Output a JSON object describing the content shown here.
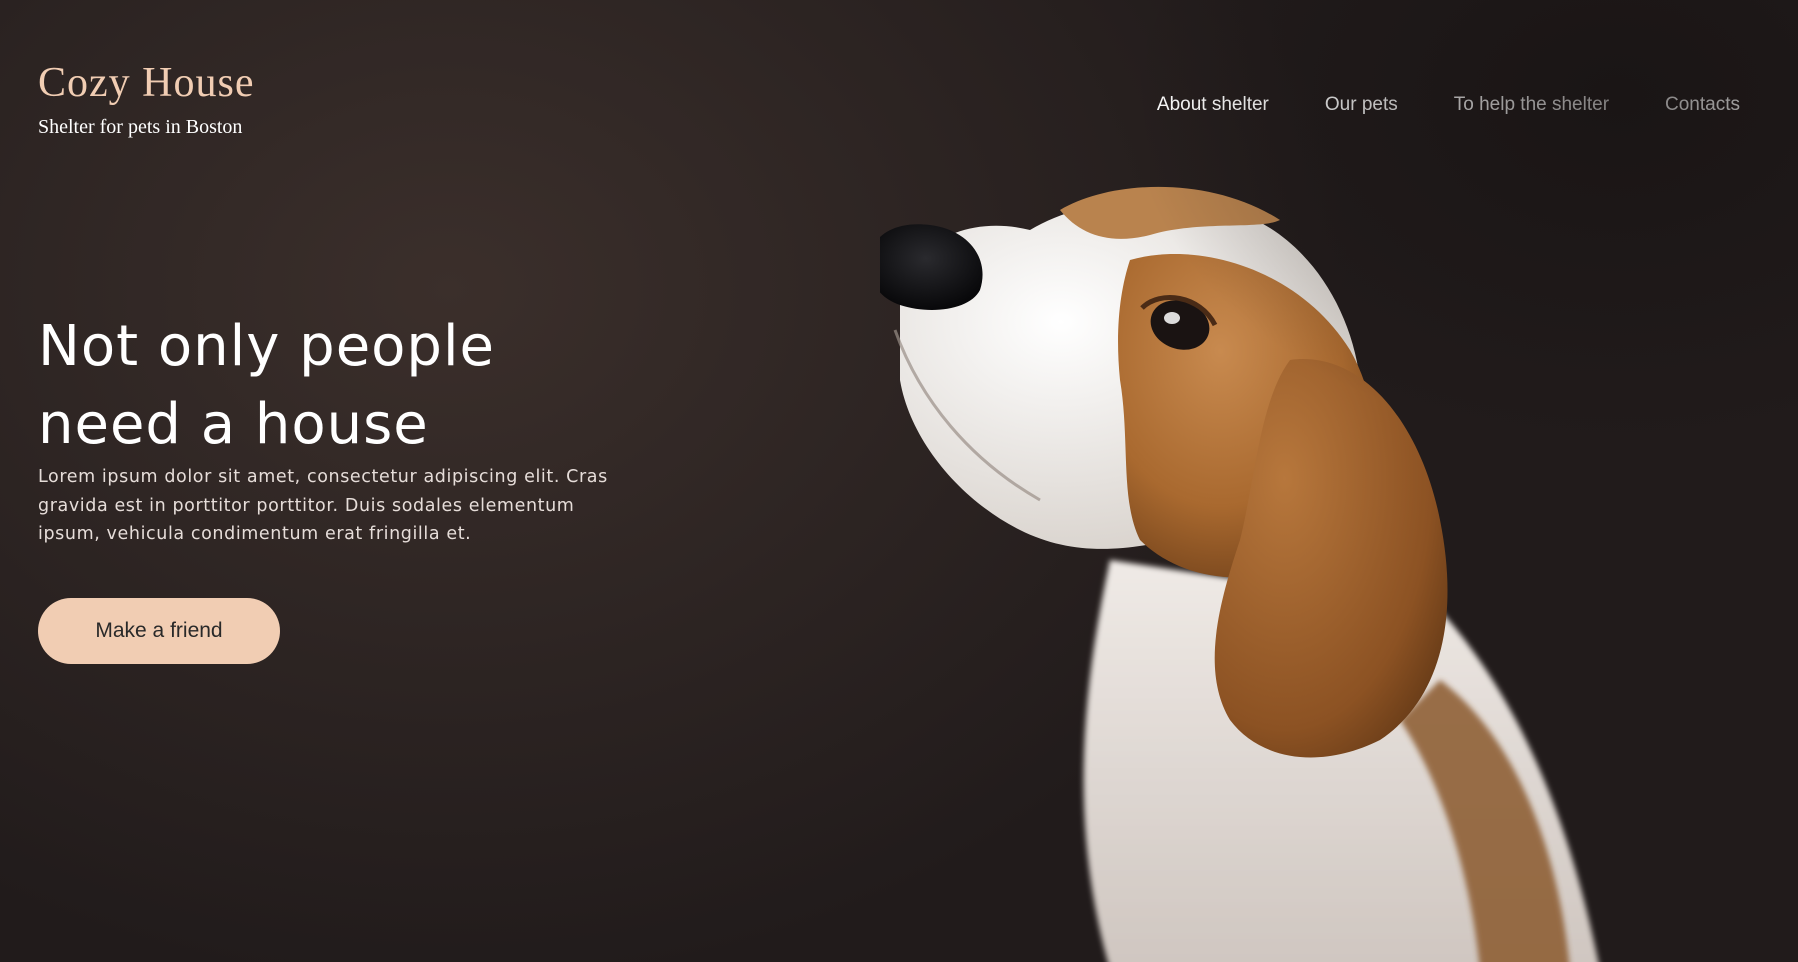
{
  "logo": {
    "title": "Cozy House",
    "subtitle": "Shelter for pets in Boston"
  },
  "nav": {
    "items": [
      "About shelter",
      "Our pets",
      "To help the shelter",
      "Contacts"
    ]
  },
  "hero": {
    "headline_line1": "Not only people",
    "headline_line2": "need a house",
    "lead": "Lorem ipsum dolor sit amet, consectetur adipiscing elit. Cras gravida est in porttitor porttitor. Duis sodales elementum ipsum, vehicula condimentum erat fringilla et.",
    "cta_label": "Make a friend",
    "image_subject": "beagle-puppy"
  },
  "colors": {
    "accent": "#f1cdb3",
    "background_dark": "#2b2321",
    "text_light": "#ffffff"
  }
}
